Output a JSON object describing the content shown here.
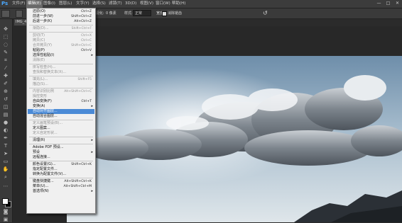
{
  "app": {
    "logo": "Ps"
  },
  "menubar": {
    "items": [
      "文件(F)",
      "编辑(E)",
      "图像(I)",
      "图层(L)",
      "文字(Y)",
      "选择(S)",
      "滤镜(T)",
      "3D(D)",
      "视图(V)",
      "窗口(W)",
      "帮助(H)"
    ],
    "window_controls": [
      "—",
      "□",
      "✕"
    ]
  },
  "options": {
    "feather_label": "羽化:",
    "feather_value": "0 像素",
    "antialias_label": "消除锯齿",
    "style_label": "样式:",
    "style_value": "正常",
    "width_label": "宽度:",
    "height_label": "高度:",
    "refine_label": "调整边缘..."
  },
  "document": {
    "tab": "IMG_4019.JPG"
  },
  "edit_menu": {
    "items": [
      {
        "label": "还原(O)",
        "shortcut": "Ctrl+Z",
        "state": "normal"
      },
      {
        "label": "前进一步(W)",
        "shortcut": "Shift+Ctrl+Z",
        "state": "normal"
      },
      {
        "label": "后退一步(K)",
        "shortcut": "Alt+Ctrl+Z",
        "state": "normal"
      },
      {
        "type": "sep"
      },
      {
        "label": "渐隐(D)...",
        "shortcut": "Shift+Ctrl+F",
        "state": "disabled"
      },
      {
        "type": "sep"
      },
      {
        "label": "剪切(T)",
        "shortcut": "Ctrl+X",
        "state": "disabled"
      },
      {
        "label": "拷贝(C)",
        "shortcut": "Ctrl+C",
        "state": "disabled"
      },
      {
        "label": "合并拷贝(Y)",
        "shortcut": "Shift+Ctrl+C",
        "state": "disabled"
      },
      {
        "label": "粘贴(P)",
        "shortcut": "Ctrl+V",
        "state": "normal"
      },
      {
        "label": "选择性粘贴(I)",
        "shortcut": "",
        "state": "normal",
        "submenu": true
      },
      {
        "label": "清除(E)",
        "shortcut": "",
        "state": "disabled"
      },
      {
        "type": "sep"
      },
      {
        "label": "拼写检查(H)...",
        "shortcut": "",
        "state": "disabled"
      },
      {
        "label": "查找和替换文本(X)...",
        "shortcut": "",
        "state": "disabled"
      },
      {
        "type": "sep"
      },
      {
        "label": "填充(L)...",
        "shortcut": "Shift+F5",
        "state": "disabled"
      },
      {
        "label": "描边(S)...",
        "shortcut": "",
        "state": "disabled"
      },
      {
        "type": "sep"
      },
      {
        "label": "内容识别比例",
        "shortcut": "Alt+Shift+Ctrl+C",
        "state": "disabled"
      },
      {
        "label": "操控变形",
        "shortcut": "",
        "state": "disabled"
      },
      {
        "label": "自由变换(F)",
        "shortcut": "Ctrl+T",
        "state": "normal"
      },
      {
        "label": "变换(A)",
        "shortcut": "",
        "state": "normal",
        "submenu": true
      },
      {
        "label": "自动对齐图层...",
        "shortcut": "",
        "state": "highlight"
      },
      {
        "label": "自动混合图层...",
        "shortcut": "",
        "state": "normal"
      },
      {
        "type": "sep"
      },
      {
        "label": "定义画笔预设(B)...",
        "shortcut": "",
        "state": "disabled"
      },
      {
        "label": "定义图案...",
        "shortcut": "",
        "state": "normal"
      },
      {
        "label": "定义自定形状...",
        "shortcut": "",
        "state": "disabled"
      },
      {
        "type": "sep"
      },
      {
        "label": "清理(R)",
        "shortcut": "",
        "state": "normal",
        "submenu": true
      },
      {
        "type": "sep"
      },
      {
        "label": "Adobe PDF 预设...",
        "shortcut": "",
        "state": "normal"
      },
      {
        "label": "预设",
        "shortcut": "",
        "state": "normal",
        "submenu": true
      },
      {
        "label": "远程连接...",
        "shortcut": "",
        "state": "normal"
      },
      {
        "type": "sep"
      },
      {
        "label": "颜色设置(G)...",
        "shortcut": "Shift+Ctrl+K",
        "state": "normal"
      },
      {
        "label": "指定配置文件...",
        "shortcut": "",
        "state": "normal"
      },
      {
        "label": "转换为配置文件(V)...",
        "shortcut": "",
        "state": "normal"
      },
      {
        "type": "sep"
      },
      {
        "label": "键盘快捷键...",
        "shortcut": "Alt+Shift+Ctrl+K",
        "state": "normal"
      },
      {
        "label": "菜单(U)...",
        "shortcut": "Alt+Shift+Ctrl+M",
        "state": "normal"
      },
      {
        "label": "首选项(N)",
        "shortcut": "",
        "state": "normal",
        "submenu": true
      }
    ]
  },
  "tools": [
    "move-tool",
    "marquee-tool",
    "lasso-tool",
    "quick-select-tool",
    "crop-tool",
    "eyedropper-tool",
    "healing-tool",
    "brush-tool",
    "clone-tool",
    "history-brush-tool",
    "eraser-tool",
    "gradient-tool",
    "blur-tool",
    "dodge-tool",
    "pen-tool",
    "type-tool",
    "path-select-tool",
    "shape-tool",
    "hand-tool",
    "zoom-tool"
  ],
  "colors": {
    "highlight": "#4a8ad6",
    "menu_bg": "#f0f0f0",
    "ui_bg": "#2b2b2b",
    "ps_blue": "#4aa8ff"
  }
}
